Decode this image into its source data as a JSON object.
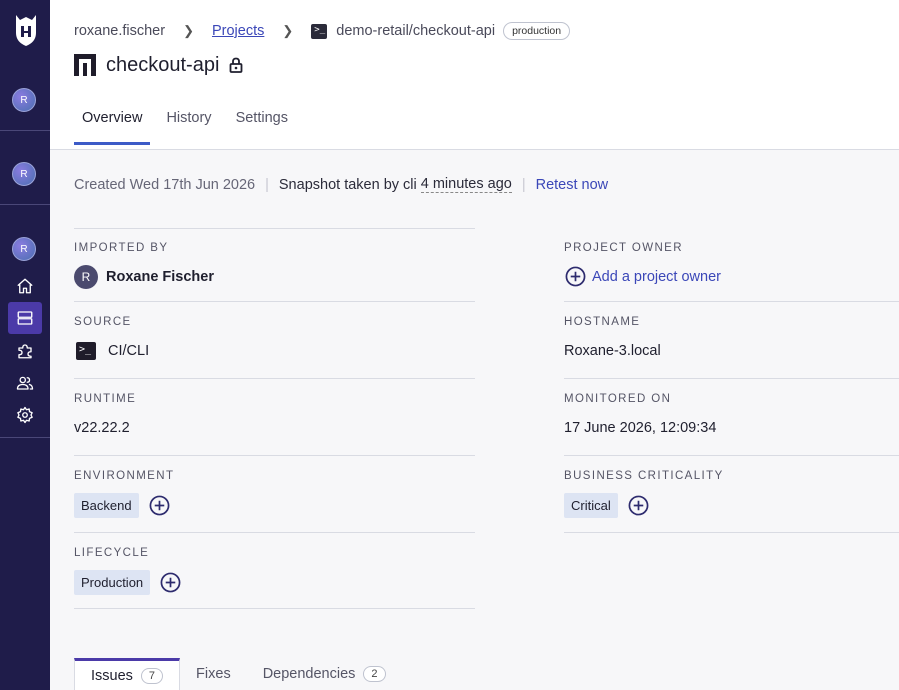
{
  "sidebar": {
    "avatar_initials": [
      "R",
      "R",
      "R"
    ],
    "icons": [
      "home-icon",
      "projects-icon",
      "integrations-icon",
      "members-icon",
      "settings-icon"
    ],
    "active_icon": "projects-icon",
    "bg_color": "#1f1c4a"
  },
  "breadcrumb": {
    "org": "roxane.fischer",
    "projects": "Projects",
    "target": "demo-retail/checkout-api",
    "env_badge": "production"
  },
  "page": {
    "title": "checkout-api"
  },
  "tabs": [
    "Overview",
    "History",
    "Settings"
  ],
  "active_tab": "Overview",
  "meta": {
    "created": "Created Wed 17th Jun 2026",
    "snapshot_prefix": "Snapshot taken by cli",
    "snapshot_time": "4 minutes ago",
    "retest": "Retest now"
  },
  "attributes": {
    "imported_by": {
      "label": "IMPORTED BY",
      "initial": "R",
      "name": "Roxane Fischer"
    },
    "project_owner": {
      "label": "PROJECT OWNER",
      "action": "Add a project owner"
    },
    "source": {
      "label": "SOURCE",
      "value": "CI/CLI"
    },
    "hostname": {
      "label": "HOSTNAME",
      "value": "Roxane-3.local"
    },
    "runtime": {
      "label": "RUNTIME",
      "value": "v22.22.2"
    },
    "monitored_on": {
      "label": "MONITORED ON",
      "value": "17 June 2026, 12:09:34"
    },
    "environment": {
      "label": "ENVIRONMENT",
      "tag": "Backend"
    },
    "business_criticality": {
      "label": "BUSINESS CRITICALITY",
      "tag": "Critical"
    },
    "lifecycle": {
      "label": "LIFECYCLE",
      "tag": "Production"
    }
  },
  "bottom_tabs": {
    "issues": {
      "label": "Issues",
      "count": "7"
    },
    "fixes": {
      "label": "Fixes"
    },
    "dependencies": {
      "label": "Dependencies",
      "count": "2"
    }
  },
  "colors": {
    "accent": "#3d5bc7",
    "link": "#3b47b8",
    "tag_bg": "#dde4f3"
  }
}
